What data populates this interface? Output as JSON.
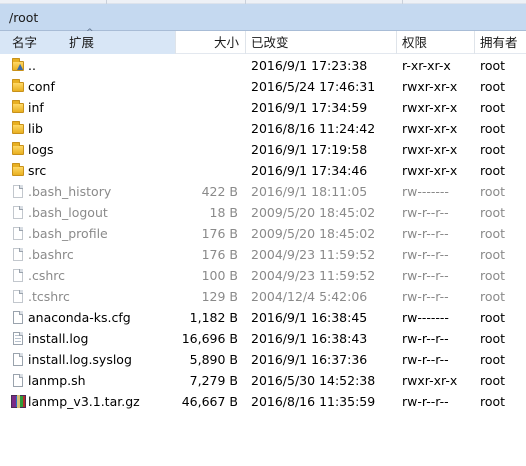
{
  "path": "/root",
  "columns": {
    "name": "名字",
    "ext": "扩展",
    "sort_indicator": "^",
    "size": "大小",
    "modified": "已改变",
    "permissions": "权限",
    "owner": "拥有者"
  },
  "files": [
    {
      "name": "..",
      "size": "",
      "modified": "2016/9/1 17:23:38",
      "permissions": "r-xr-xr-x",
      "owner": "root",
      "type": "parent",
      "icon": "folder-up-icon",
      "hidden": false
    },
    {
      "name": "conf",
      "size": "",
      "modified": "2016/5/24 17:46:31",
      "permissions": "rwxr-xr-x",
      "owner": "root",
      "type": "folder",
      "icon": "folder-icon",
      "hidden": false
    },
    {
      "name": "inf",
      "size": "",
      "modified": "2016/9/1 17:34:59",
      "permissions": "rwxr-xr-x",
      "owner": "root",
      "type": "folder",
      "icon": "folder-icon",
      "hidden": false
    },
    {
      "name": "lib",
      "size": "",
      "modified": "2016/8/16 11:24:42",
      "permissions": "rwxr-xr-x",
      "owner": "root",
      "type": "folder",
      "icon": "folder-icon",
      "hidden": false
    },
    {
      "name": "logs",
      "size": "",
      "modified": "2016/9/1 17:19:58",
      "permissions": "rwxr-xr-x",
      "owner": "root",
      "type": "folder",
      "icon": "folder-icon",
      "hidden": false
    },
    {
      "name": "src",
      "size": "",
      "modified": "2016/9/1 17:34:46",
      "permissions": "rwxr-xr-x",
      "owner": "root",
      "type": "folder",
      "icon": "folder-icon",
      "hidden": false
    },
    {
      "name": ".bash_history",
      "size": "422 B",
      "modified": "2016/9/1 18:11:05",
      "permissions": "rw-------",
      "owner": "root",
      "type": "file",
      "icon": "file-icon",
      "hidden": true
    },
    {
      "name": ".bash_logout",
      "size": "18 B",
      "modified": "2009/5/20 18:45:02",
      "permissions": "rw-r--r--",
      "owner": "root",
      "type": "file",
      "icon": "file-icon",
      "hidden": true
    },
    {
      "name": ".bash_profile",
      "size": "176 B",
      "modified": "2009/5/20 18:45:02",
      "permissions": "rw-r--r--",
      "owner": "root",
      "type": "file",
      "icon": "file-icon",
      "hidden": true
    },
    {
      "name": ".bashrc",
      "size": "176 B",
      "modified": "2004/9/23 11:59:52",
      "permissions": "rw-r--r--",
      "owner": "root",
      "type": "file",
      "icon": "file-icon",
      "hidden": true
    },
    {
      "name": ".cshrc",
      "size": "100 B",
      "modified": "2004/9/23 11:59:52",
      "permissions": "rw-r--r--",
      "owner": "root",
      "type": "file",
      "icon": "file-icon",
      "hidden": true
    },
    {
      "name": ".tcshrc",
      "size": "129 B",
      "modified": "2004/12/4 5:42:06",
      "permissions": "rw-r--r--",
      "owner": "root",
      "type": "file",
      "icon": "file-icon",
      "hidden": true
    },
    {
      "name": "anaconda-ks.cfg",
      "size": "1,182 B",
      "modified": "2016/9/1 16:38:45",
      "permissions": "rw-------",
      "owner": "root",
      "type": "file",
      "icon": "file-icon",
      "hidden": false
    },
    {
      "name": "install.log",
      "size": "16,696 B",
      "modified": "2016/9/1 16:38:43",
      "permissions": "rw-r--r--",
      "owner": "root",
      "type": "text",
      "icon": "text-file-icon",
      "hidden": false
    },
    {
      "name": "install.log.syslog",
      "size": "5,890 B",
      "modified": "2016/9/1 16:37:36",
      "permissions": "rw-r--r--",
      "owner": "root",
      "type": "file",
      "icon": "file-icon",
      "hidden": false
    },
    {
      "name": "lanmp.sh",
      "size": "7,279 B",
      "modified": "2016/5/30 14:52:38",
      "permissions": "rwxr-xr-x",
      "owner": "root",
      "type": "file",
      "icon": "file-icon",
      "hidden": false
    },
    {
      "name": "lanmp_v3.1.tar.gz",
      "size": "46,667 B",
      "modified": "2016/8/16 11:35:59",
      "permissions": "rw-r--r--",
      "owner": "root",
      "type": "archive",
      "icon": "archive-icon",
      "hidden": false
    }
  ]
}
